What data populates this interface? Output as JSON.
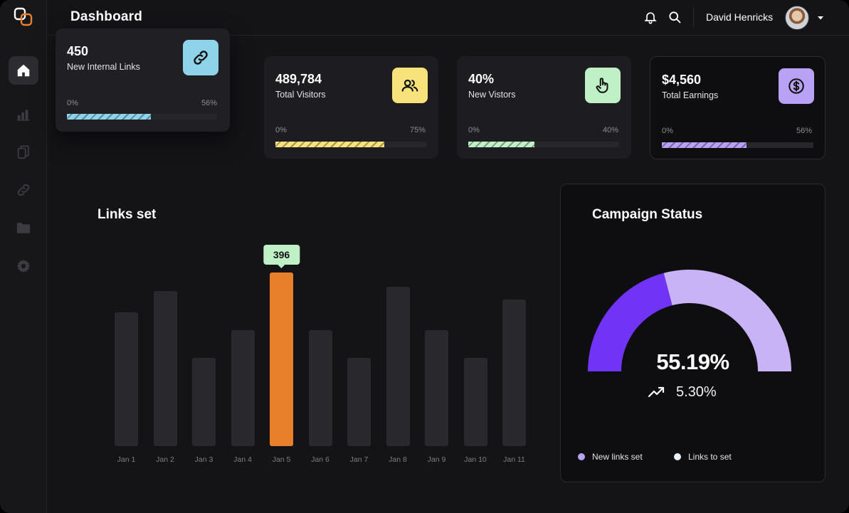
{
  "header": {
    "title": "Dashboard",
    "user_name": "David Henricks"
  },
  "sidebar": {
    "items": [
      {
        "icon": "home-icon",
        "active": true
      },
      {
        "icon": "bar-chart-icon",
        "active": false
      },
      {
        "icon": "documents-icon",
        "active": false
      },
      {
        "icon": "link-icon",
        "active": false
      },
      {
        "icon": "folder-icon",
        "active": false
      },
      {
        "icon": "gear-icon",
        "active": false
      }
    ]
  },
  "stats": [
    {
      "value": "450",
      "label": "New Internal Links",
      "min": "0%",
      "max": "56%",
      "progress": 0.56,
      "accent": "#8fd3ea",
      "icon": "link-icon"
    },
    {
      "value": "489,784",
      "label": "Total Visitors",
      "min": "0%",
      "max": "75%",
      "progress": 0.72,
      "accent": "#f8e27c",
      "icon": "users-icon"
    },
    {
      "value": "40%",
      "label": "New Vistors",
      "min": "0%",
      "max": "40%",
      "progress": 0.44,
      "accent": "#bff0c6",
      "icon": "pointer-hand-icon"
    },
    {
      "value": "$4,560",
      "label": "Total Earnings",
      "min": "0%",
      "max": "56%",
      "progress": 0.56,
      "accent": "#b9a2f5",
      "icon": "dollar-icon"
    }
  ],
  "links_chart": {
    "title": "Links set",
    "highlight_color": "#e87f2b",
    "tooltip_color": "#bff0c6"
  },
  "chart_data": {
    "type": "bar",
    "title": "Links set",
    "categories": [
      "Jan 1",
      "Jan 2",
      "Jan 3",
      "Jan 4",
      "Jan 5",
      "Jan 6",
      "Jan 7",
      "Jan 8",
      "Jan 9",
      "Jan 10",
      "Jan 11"
    ],
    "values": [
      305,
      355,
      202,
      265,
      396,
      265,
      202,
      364,
      265,
      202,
      335
    ],
    "highlighted_category": "Jan 5",
    "highlighted_label": "396",
    "ylim": [
      0,
      400
    ]
  },
  "campaign": {
    "title": "Campaign Status",
    "value": "55.19%",
    "delta": "5.30%",
    "gauge_fraction": 0.5519,
    "colors": {
      "primary": "#7133f5",
      "secondary": "#c9b3f7"
    },
    "legend": [
      {
        "label": "New links set",
        "color": "#b9a2f5"
      },
      {
        "label": "Links to set",
        "color": "#e6f1fb"
      }
    ]
  }
}
